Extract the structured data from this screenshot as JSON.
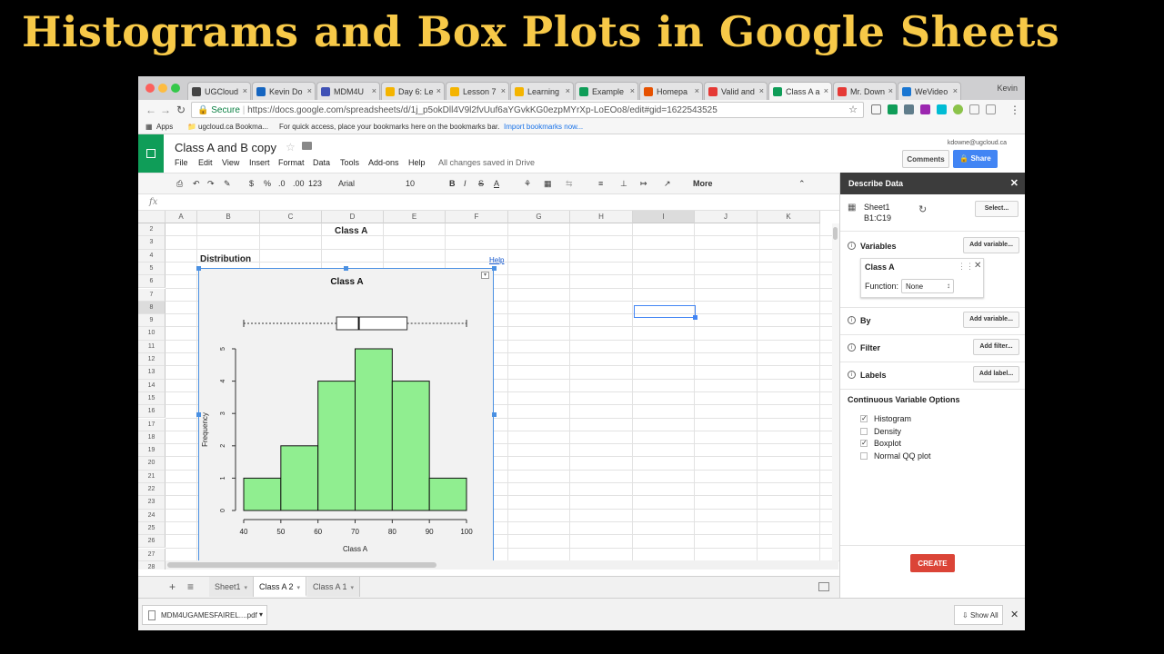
{
  "banner": {
    "title": "Histograms and Box Plots in Google Sheets"
  },
  "browser": {
    "tabs": [
      {
        "label": "UGCloud",
        "favicon": "#444444"
      },
      {
        "label": "Kevin Do",
        "favicon": "#1565c0"
      },
      {
        "label": "MDM4U",
        "favicon": "#3f51b5"
      },
      {
        "label": "Day 6: Le",
        "favicon": "#f4b400"
      },
      {
        "label": "Lesson 7",
        "favicon": "#f4b400"
      },
      {
        "label": "Learning",
        "favicon": "#f4b400"
      },
      {
        "label": "Example",
        "favicon": "#0f9d58"
      },
      {
        "label": "Homepa",
        "favicon": "#e65100"
      },
      {
        "label": "Valid and",
        "favicon": "#e53935"
      },
      {
        "label": "Class A a",
        "favicon": "#0f9d58"
      },
      {
        "label": "Mr. Down",
        "favicon": "#e53935"
      },
      {
        "label": "WeVideo",
        "favicon": "#1976d2"
      }
    ],
    "user": "Kevin",
    "secure_label": "Secure",
    "url": "https://docs.google.com/spreadsheets/d/1j_p5okDll4V9l2fvUuf6aYGvkKG0ezpMYrXp-LoEOo8/edit#gid=1622543525",
    "bookmarks": {
      "apps": "Apps",
      "first": "ugcloud.ca Bookma...",
      "hint": "For quick access, place your bookmarks here on the bookmarks bar.",
      "import_link": "Import bookmarks now..."
    }
  },
  "docs": {
    "title": "Class A and B copy",
    "menu": [
      "File",
      "Edit",
      "View",
      "Insert",
      "Format",
      "Data",
      "Tools",
      "Add-ons",
      "Help"
    ],
    "saved_status": "All changes saved in Drive",
    "account": "kdowne@ugcloud.ca",
    "comments_label": "Comments",
    "share_label": "Share",
    "toolbar": {
      "currency": "$",
      "percent": "%",
      "dec_less": ".0",
      "dec_more": ".00",
      "format": "123",
      "font": "Arial",
      "size": "10",
      "bold": "B",
      "italic": "I",
      "strike": "S",
      "text_color": "A",
      "more": "More"
    },
    "formula_icon": "fx"
  },
  "sheet": {
    "columns": [
      "A",
      "B",
      "C",
      "D",
      "E",
      "F",
      "G",
      "H",
      "I",
      "J",
      "K"
    ],
    "selected_column": "I",
    "rows": [
      "2",
      "3",
      "4",
      "5",
      "6",
      "7",
      "8",
      "9",
      "10",
      "11",
      "12",
      "13",
      "14",
      "15",
      "16",
      "17",
      "18",
      "19",
      "20",
      "21",
      "22",
      "23",
      "24",
      "25",
      "26",
      "27",
      "28"
    ],
    "selected_row": "8",
    "cells": {
      "class_title": "Class A",
      "distribution": "Distribution",
      "help": "Help"
    },
    "tabs": [
      "Sheet1",
      "Class A 2",
      "Class A 1"
    ],
    "active_tab": "Class A 2"
  },
  "chart_data": {
    "type": "bar",
    "title": "Class A",
    "xlabel": "Class A",
    "ylabel": "Frequency",
    "bins": [
      [
        40,
        50
      ],
      [
        50,
        60
      ],
      [
        60,
        70
      ],
      [
        70,
        80
      ],
      [
        80,
        90
      ],
      [
        90,
        100
      ]
    ],
    "values": [
      1,
      2,
      4,
      5,
      4,
      1
    ],
    "xticks": [
      40,
      50,
      60,
      70,
      80,
      90,
      100
    ],
    "yticks": [
      0,
      1,
      2,
      3,
      4,
      5
    ],
    "xlim": [
      40,
      100
    ],
    "ylim": [
      0,
      5
    ],
    "bar_color": "#90ee90",
    "boxplot": {
      "min": 40,
      "q1": 65,
      "median": 71,
      "q3": 84,
      "max": 100
    }
  },
  "panel": {
    "title": "Describe Data",
    "range_sheet": "Sheet1",
    "range": "B1:C19",
    "select_label": "Select...",
    "variables_label": "Variables",
    "add_variable_label": "Add variable...",
    "variable_name": "Class A",
    "function_label": "Function:",
    "function_value": "None",
    "by_label": "By",
    "add_by_label": "Add variable...",
    "filter_label": "Filter",
    "add_filter_label": "Add filter...",
    "labels_label": "Labels",
    "add_label_label": "Add label...",
    "options_title": "Continuous Variable Options",
    "options": [
      {
        "label": "Histogram",
        "checked": true
      },
      {
        "label": "Density",
        "checked": false
      },
      {
        "label": "Boxplot",
        "checked": true
      },
      {
        "label": "Normal QQ plot",
        "checked": false
      }
    ],
    "create_label": "CREATE"
  },
  "downloads": {
    "file": "MDM4UGAMESFAIREL....pdf",
    "show_all": "Show All"
  }
}
